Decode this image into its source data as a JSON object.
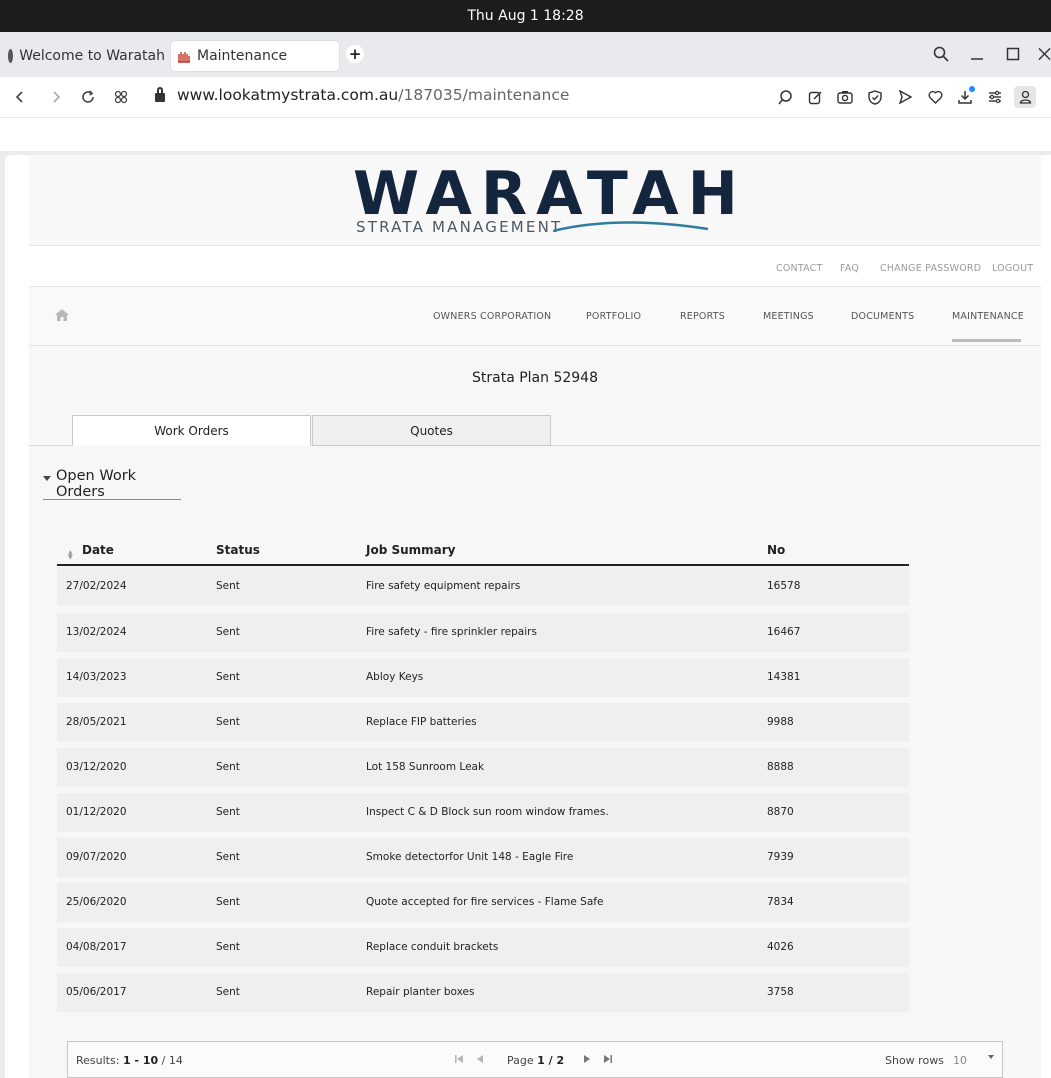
{
  "os": {
    "clock": "Thu Aug 1  18:28"
  },
  "browser": {
    "tabs": [
      {
        "label": "Welcome to Waratah"
      },
      {
        "label": "Maintenance"
      }
    ],
    "url_host": "www.lookatmystrata.com.au",
    "url_path": "/187035/maintenance"
  },
  "brand": {
    "name": "WARATAH",
    "tagline": "STRATA MANAGEMENT",
    "color": "#13263d",
    "wave_color": "#2e7ca0"
  },
  "util_links": [
    "CONTACT",
    "FAQ",
    "CHANGE PASSWORD",
    "LOGOUT"
  ],
  "nav": {
    "items": [
      "OWNERS CORPORATION",
      "PORTFOLIO",
      "REPORTS",
      "MEETINGS",
      "DOCUMENTS",
      "MAINTENANCE"
    ],
    "active": "MAINTENANCE"
  },
  "page": {
    "title": "Strata Plan 52948",
    "tabs": [
      "Work Orders",
      "Quotes"
    ],
    "section": "Open Work Orders"
  },
  "table": {
    "headers": [
      "Date",
      "Status",
      "Job Summary",
      "No"
    ],
    "rows": [
      [
        "27/02/2024",
        "Sent",
        "Fire safety equipment repairs",
        "16578"
      ],
      [
        "13/02/2024",
        "Sent",
        "Fire safety - fire sprinkler repairs",
        "16467"
      ],
      [
        "14/03/2023",
        "Sent",
        "Abloy Keys",
        "14381"
      ],
      [
        "28/05/2021",
        "Sent",
        "Replace FIP batteries",
        "9988"
      ],
      [
        "03/12/2020",
        "Sent",
        "Lot 158 Sunroom Leak",
        "8888"
      ],
      [
        "01/12/2020",
        "Sent",
        "Inspect C & D Block sun room window frames.",
        "8870"
      ],
      [
        "09/07/2020",
        "Sent",
        "Smoke detectorfor Unit 148 - Eagle Fire",
        "7939"
      ],
      [
        "25/06/2020",
        "Sent",
        "Quote accepted for fire services - Flame Safe",
        "7834"
      ],
      [
        "04/08/2017",
        "Sent",
        "Replace conduit brackets",
        "4026"
      ],
      [
        "05/06/2017",
        "Sent",
        "Repair planter boxes",
        "3758"
      ]
    ]
  },
  "pager": {
    "results_label": "Results:",
    "results_range": "1 - 10",
    "results_total": "/ 14",
    "page_label": "Page",
    "page_value": "1 / 2",
    "rows_label": "Show rows",
    "rows_value": "10"
  }
}
